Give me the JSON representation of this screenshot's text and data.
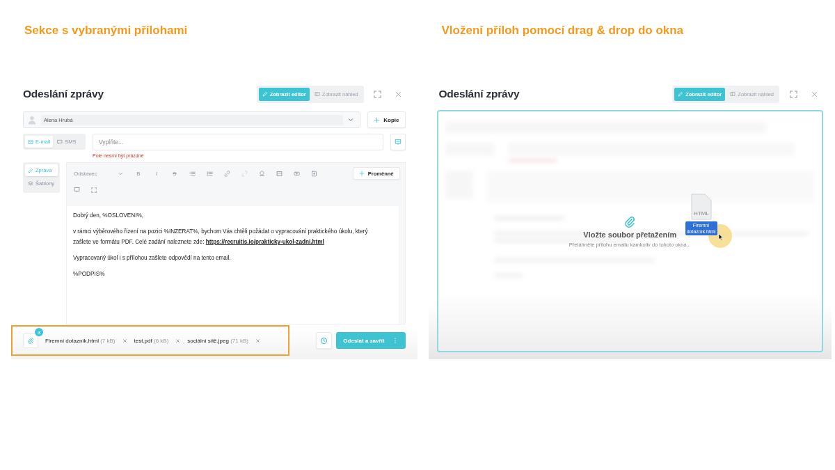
{
  "left": {
    "heading": "Sekce s vybranými přílohami",
    "dialog": {
      "title": "Odeslání zprávy",
      "view_toggle": [
        {
          "label": "Zobrazit editor",
          "selected": true
        },
        {
          "label": "Zobrazit náhled",
          "selected": false
        }
      ],
      "recipient": "Alena Hrubá",
      "cc_button": "Kopie",
      "channels": [
        {
          "label": "E-mail",
          "selected": true
        },
        {
          "label": "SMS",
          "selected": false
        }
      ],
      "subject": {
        "placeholder": "Vyplňte..."
      },
      "error": "Pole nesmí být prázdné",
      "side_tabs": [
        {
          "label": "Zpráva",
          "selected": true
        },
        {
          "label": "Šablony",
          "selected": false
        }
      ],
      "toolbar": {
        "paragraph_style": "Odstavec",
        "format_buttons": [
          "B",
          "I",
          "S"
        ],
        "variables_button": "Proměnné"
      },
      "body": [
        {
          "text": "Dobrý den, %OSLOVENI%,"
        },
        {
          "text": "v rámci výběrového řízení na pozici %INZERAT%, bychom Vás chtěli požádat o vypracování praktického úkolu, který zašlete ve formátu PDF. Celé zadání naleznete zde: ",
          "link": "https://recruitis.io/prakticky-ukol-zadni.html"
        },
        {
          "text": "Vypracovaný úkol i s přílohou zašlete odpovědí na tento email."
        },
        {
          "text": "%PODPIS%"
        }
      ],
      "attachments": {
        "count": "3",
        "files": [
          {
            "name": "Firemní dotazník.html",
            "size": "(7 kB)"
          },
          {
            "name": "test.pdf",
            "size": "(6 kB)"
          },
          {
            "name": "sociální sítě.jpeg",
            "size": "(71 kB)"
          }
        ]
      },
      "send_button": "Odeslat a zavřít"
    }
  },
  "right": {
    "heading": "Vložení příloh pomocí drag & drop do okna",
    "dialog": {
      "title": "Odeslání zprávy",
      "view_toggle": [
        {
          "label": "Zobrazit editor",
          "selected": true
        },
        {
          "label": "Zobrazit náhled",
          "selected": false
        }
      ],
      "drop_zone": {
        "title": "Vložte soubor přetažením",
        "hint": "Přetáhněte přílohu emailu kamkoliv do tohoto okna..."
      },
      "dragged_file": {
        "ext": "HTML",
        "label": "Firemní dotazník.html"
      }
    }
  }
}
